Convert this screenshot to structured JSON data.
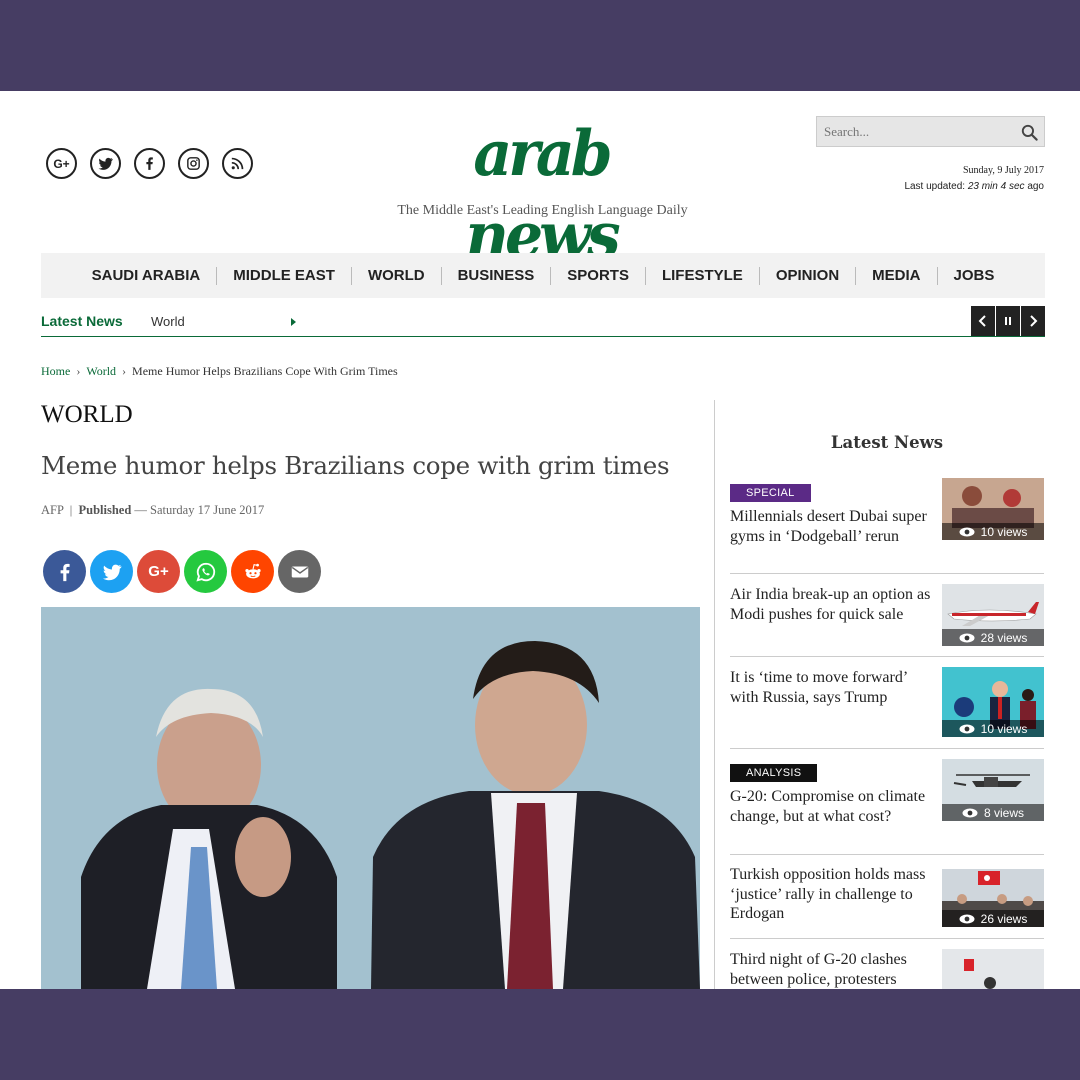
{
  "header": {
    "logo": "arab news",
    "tagline": "The Middle East's Leading English Language Daily",
    "search_placeholder": "Search...",
    "date": "Sunday, 9 July 2017",
    "last_updated_label": "Last updated:",
    "last_updated_value": "23 min 4 sec",
    "last_updated_suffix": "ago",
    "social_icons": [
      "google-plus-icon",
      "twitter-icon",
      "facebook-icon",
      "instagram-icon",
      "rss-icon"
    ]
  },
  "nav": {
    "items": [
      "SAUDI ARABIA",
      "MIDDLE EAST",
      "WORLD",
      "BUSINESS",
      "SPORTS",
      "LIFESTYLE",
      "OPINION",
      "MEDIA",
      "JOBS"
    ]
  },
  "ticker": {
    "label": "Latest News",
    "item": "World"
  },
  "breadcrumb": {
    "home": "Home",
    "section": "World",
    "current": "Meme Humor Helps Brazilians Cope With Grim Times"
  },
  "article": {
    "section": "WORLD",
    "headline": "Meme humor helps Brazilians cope with grim times",
    "source": "AFP",
    "published_label": "Published",
    "published_date": "Saturday 17 June 2017",
    "share_icons": [
      "facebook-icon",
      "twitter-icon",
      "google-plus-icon",
      "whatsapp-icon",
      "reddit-icon",
      "email-icon"
    ]
  },
  "sidebar": {
    "title": "Latest News",
    "items": [
      {
        "tag": "SPECIAL",
        "headline": "Millennials desert Dubai super gyms in ‘Dodgeball’ rerun",
        "views": "10 views"
      },
      {
        "tag": "",
        "headline": "Air India break-up an option as Modi pushes for quick sale",
        "views": "28 views"
      },
      {
        "tag": "",
        "headline": "It is ‘time to move forward’ with Russia, says Trump",
        "views": "10 views"
      },
      {
        "tag": "ANALYSIS",
        "headline": "G-20: Compromise on climate change, but at what cost?",
        "views": "8 views"
      },
      {
        "tag": "",
        "headline": "Turkish opposition holds mass ‘justice’ rally in challenge to Erdogan",
        "views": "26 views"
      },
      {
        "tag": "",
        "headline": "Third night of G-20 clashes between police, protesters",
        "views": ""
      }
    ]
  },
  "colors": {
    "brand_green": "#0a6a38",
    "frame": "#463d63",
    "special_tag": "#5b2a86",
    "analysis_tag": "#111111"
  }
}
